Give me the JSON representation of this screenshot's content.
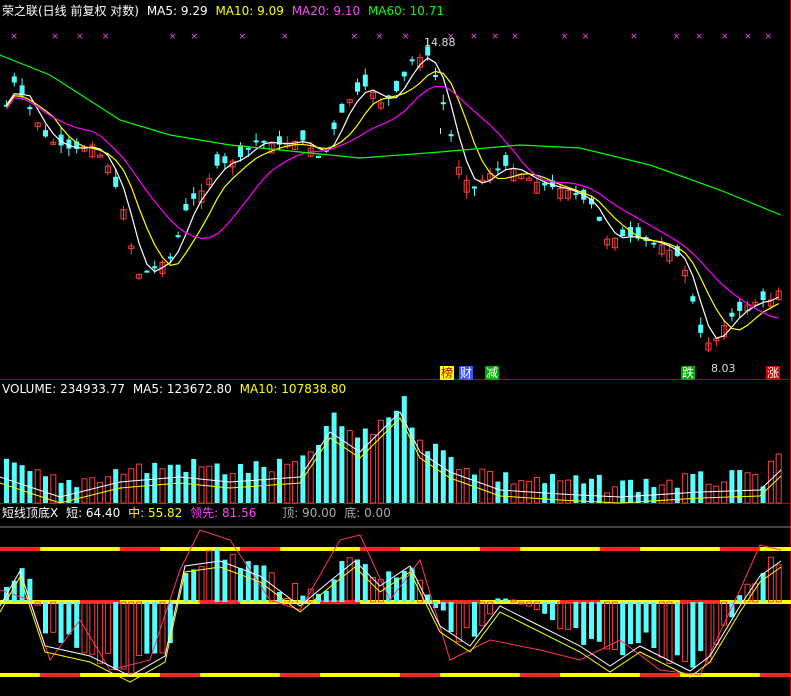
{
  "main_header": {
    "stock": "荣之联(日线 前复权 对数)",
    "ma5": "MA5: 9.29",
    "ma10": "MA10: 9.09",
    "ma20": "MA20: 9.10",
    "ma60": "MA60: 10.71"
  },
  "volume_header": {
    "volume": "VOLUME: 234933.77",
    "ma5": "MA5: 123672.80",
    "ma10": "MA10: 107838.80"
  },
  "indicator_header": {
    "name": "短线顶底X",
    "short": "短: 64.40",
    "mid": "中: 55.82",
    "lead": "领先: 81.56",
    "top": "顶: 90.00",
    "bottom": "底: 0.00"
  },
  "annotations": {
    "high_price": "14.88",
    "low_price": "8.03",
    "tag_bang": "榜",
    "tag_cai": "财",
    "tag_jian": "减",
    "tag_die": "跌",
    "tag_zhang": "涨",
    "tick_mark": "ı"
  },
  "colors": {
    "up": "#ff3b3b",
    "down": "#54ffff",
    "ma5": "#ffffff",
    "ma10": "#ffff00",
    "ma20": "#ff00ff",
    "ma60": "#00ff00",
    "grid_red": "#b00000"
  },
  "chart_data": {
    "type": "candlestick",
    "low_label": 8.03,
    "high_label": 14.88
  }
}
